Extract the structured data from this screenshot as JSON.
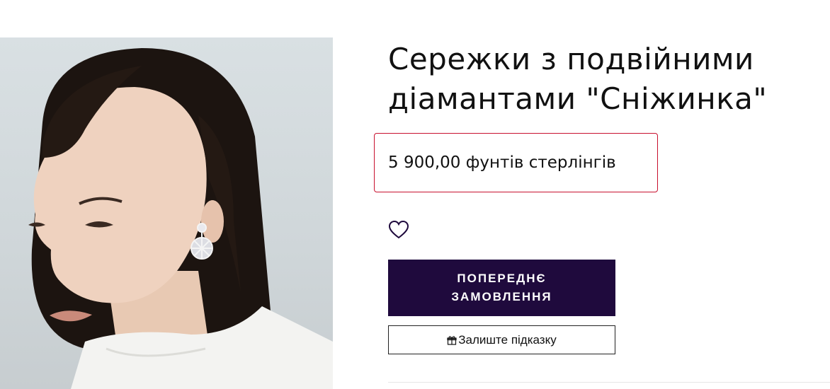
{
  "product": {
    "title": "Сережки з подвійними діамантами \"Сніжинка\"",
    "price": "5 900,00 фунтів стерлінгів",
    "image_alt": "Модель у сережках-сніжинках"
  },
  "actions": {
    "wishlist_icon": "heart-icon",
    "preorder_label": "ПОПЕРЕДНЄ ЗАМОВЛЕННЯ",
    "hint_icon": "gift-icon",
    "hint_label": "Залиште підказку"
  },
  "colors": {
    "primary_button": "#1f0a3d",
    "price_highlight_border": "#c8102e",
    "background": "#ffffff"
  }
}
